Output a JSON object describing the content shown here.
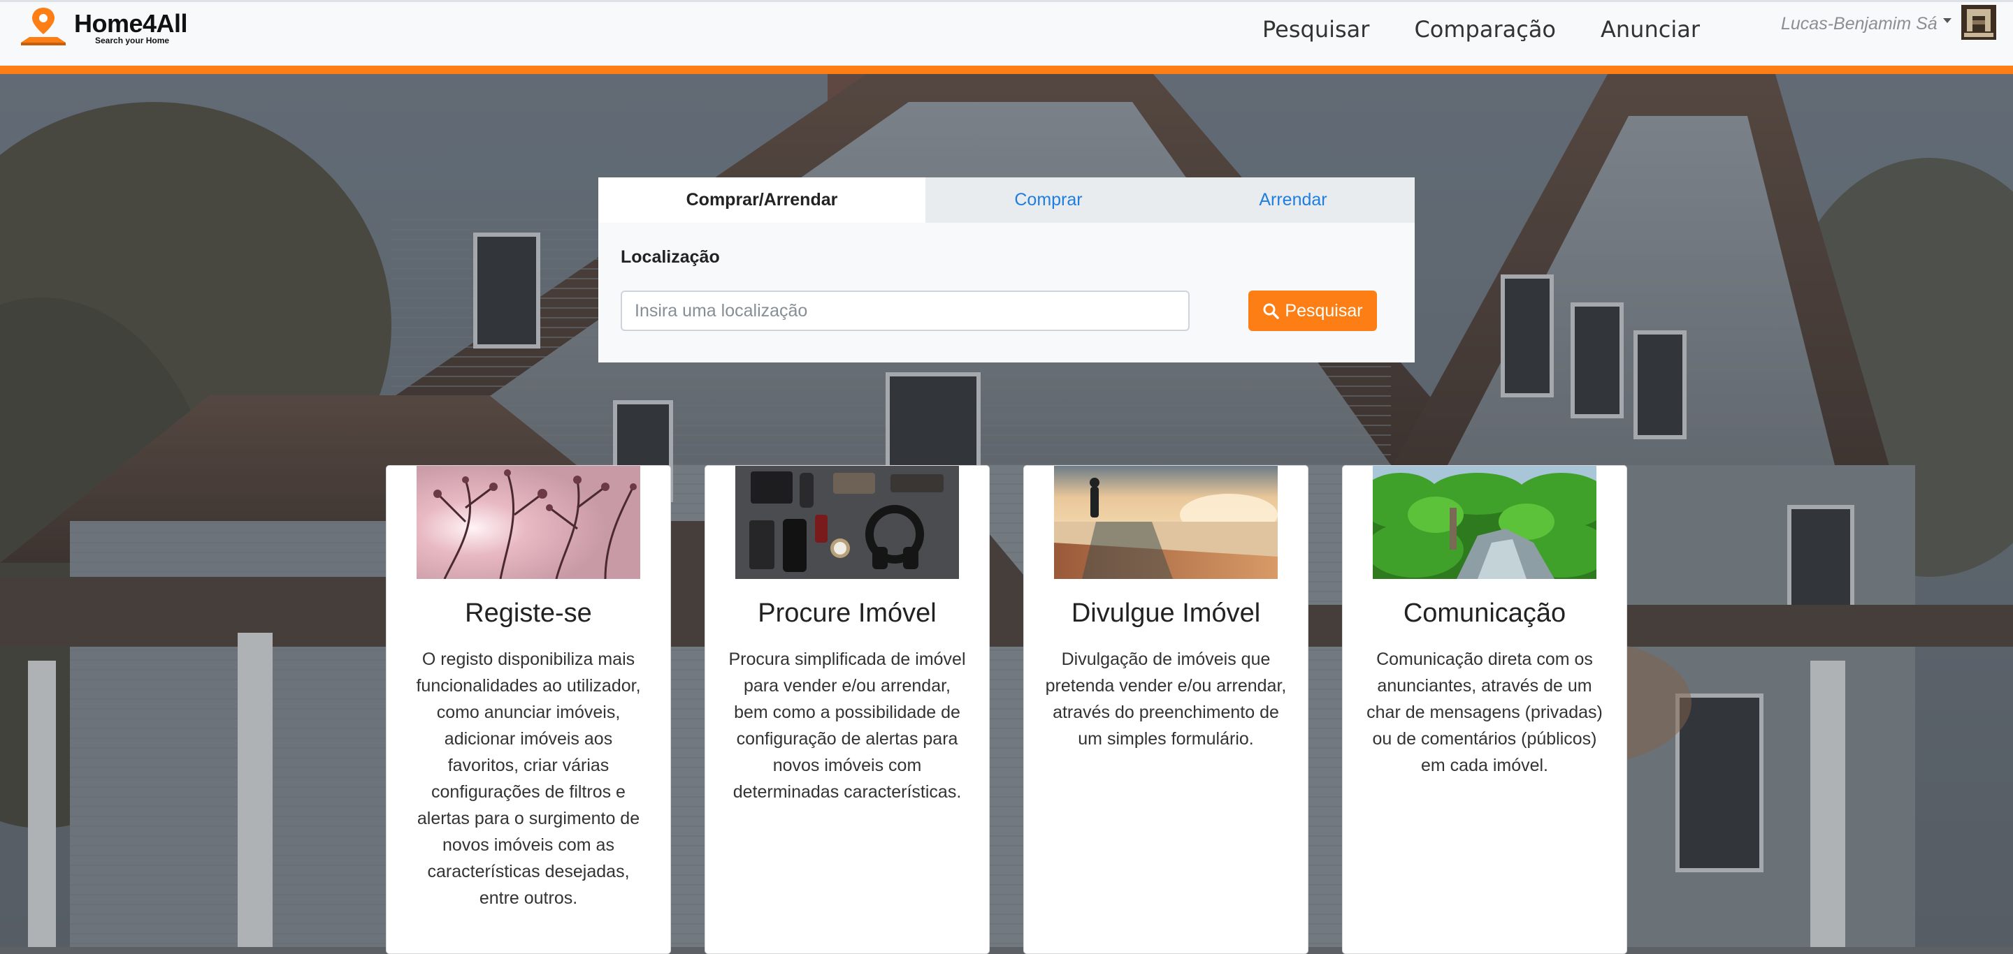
{
  "brand": {
    "name": "Home4All",
    "tagline": "Search your Home"
  },
  "nav": {
    "links": [
      "Pesquisar",
      "Comparação",
      "Anunciar"
    ],
    "user_name": "Lucas-Benjamim Sá"
  },
  "colors": {
    "accent": "#fd7e14",
    "link": "#1f7ee0"
  },
  "search": {
    "tabs": [
      "Comprar/Arrendar",
      "Comprar",
      "Arrendar"
    ],
    "active_tab": "Comprar/Arrendar",
    "location_label": "Localização",
    "location_placeholder": "Insira uma localização",
    "location_value": "",
    "button_label": "Pesquisar"
  },
  "cards": [
    {
      "title": "Registe-se",
      "image": "pink-blossom-branches",
      "text": "O registo disponibiliza mais funcionalidades ao utilizador, como anunciar imóveis, adicionar imóveis aos favoritos, criar várias configurações de filtros e alertas para o surgimento de novos imóveis com as características desejadas, entre outros."
    },
    {
      "title": "Procure Imóvel",
      "image": "flat-lay-accessories",
      "text": "Procura simplificada de imóvel para vender e/ou arrendar, bem como a possibilidade de configuração de alertas para novos imóveis com determinadas características."
    },
    {
      "title": "Divulgue Imóvel",
      "image": "person-on-seashore-sunset",
      "text": "Divulgação de imóveis que pretenda vender e/ou arrendar, através do preenchimento de um simples formulário."
    },
    {
      "title": "Comunicação",
      "image": "green-forest-river",
      "text": "Comunicação direta com os anunciantes, através de um char de mensagens (privadas) ou de comentários (públicos) em cada imóvel."
    }
  ]
}
